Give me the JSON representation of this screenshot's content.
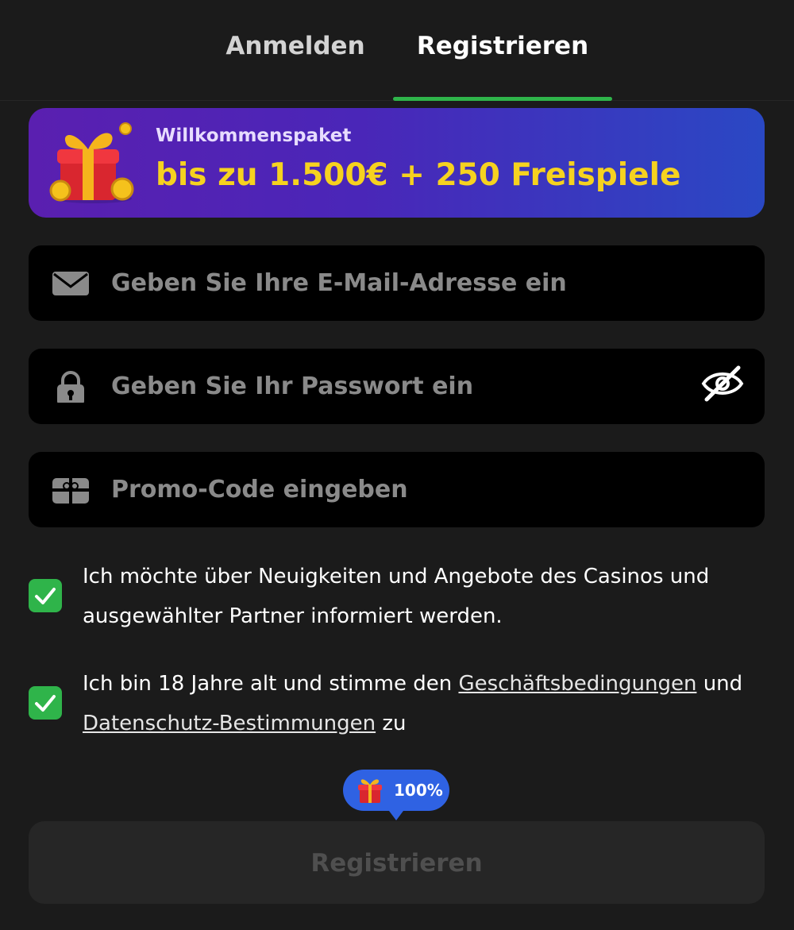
{
  "tabs": {
    "login": "Anmelden",
    "register": "Registrieren",
    "active": "register"
  },
  "banner": {
    "subtitle": "Willkommenspaket",
    "offer": "bis zu 1.500€ + 250 Freispiele",
    "icon": "gift-icon",
    "colors": {
      "gradient_start": "#5a1fb0",
      "gradient_end": "#2a48c4",
      "offer_text": "#f6d21f"
    }
  },
  "form": {
    "email": {
      "placeholder": "Geben Sie Ihre E-Mail-Adresse ein",
      "value": "",
      "icon": "envelope-icon"
    },
    "password": {
      "placeholder": "Geben Sie Ihr Passwort ein",
      "value": "",
      "icon": "lock-icon",
      "toggle_icon": "eye-off-icon"
    },
    "promo": {
      "placeholder": "Promo-Code eingeben",
      "value": "",
      "icon": "gift-card-icon"
    }
  },
  "consents": {
    "newsletter": {
      "checked": true,
      "text": "Ich möchte über Neuigkeiten und Angebote des Casinos und ausgewählter Partner informiert werden."
    },
    "terms": {
      "checked": true,
      "text_before": "Ich bin 18 Jahre alt und stimme den ",
      "terms_link": "Geschäftsbedingungen",
      "text_middle": " und ",
      "privacy_link": "Datenschutz-Bestimmungen",
      "text_after": " zu"
    }
  },
  "progress": {
    "label": "100%",
    "value": 100,
    "icon": "gift-icon"
  },
  "submit": {
    "label": "Registrieren",
    "enabled": false
  },
  "colors": {
    "accent_green": "#2fb44a",
    "background": "#1b1b1b",
    "field_bg": "#000000",
    "badge_blue": "#2f62e3"
  }
}
